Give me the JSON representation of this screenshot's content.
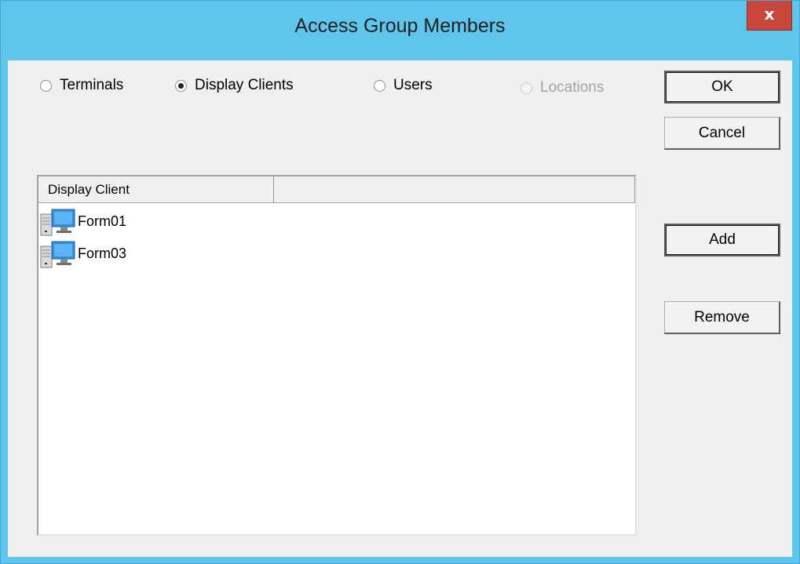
{
  "window": {
    "title": "Access Group Members",
    "close_glyph": "x"
  },
  "radios": [
    {
      "label": "Terminals",
      "checked": false,
      "enabled": true
    },
    {
      "label": "Display Clients",
      "checked": true,
      "enabled": true
    },
    {
      "label": "Users",
      "checked": false,
      "enabled": true
    },
    {
      "label": "Locations",
      "checked": false,
      "enabled": false
    }
  ],
  "buttons": {
    "ok": "OK",
    "cancel": "Cancel",
    "add": "Add",
    "remove": "Remove"
  },
  "list": {
    "columns": [
      "Display Client",
      ""
    ],
    "rows": [
      {
        "icon": "display-client-icon",
        "name": "Form01"
      },
      {
        "icon": "display-client-icon",
        "name": "Form03"
      }
    ]
  },
  "colors": {
    "frame": "#5ec6ec",
    "close_button": "#c9463d",
    "dialog_background": "#f0f0f0"
  }
}
